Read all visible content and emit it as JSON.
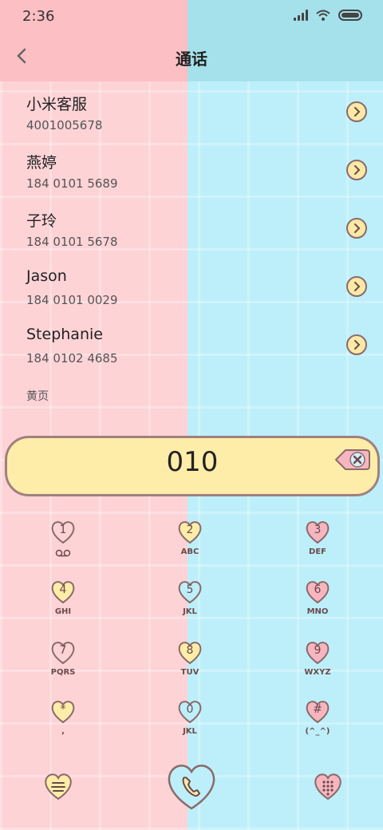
{
  "status": {
    "time": "2:36"
  },
  "header": {
    "title": "通话"
  },
  "contacts": [
    {
      "name": "小米客服",
      "phone": "4001005678"
    },
    {
      "name": "燕婷",
      "phone": "184 0101 5689"
    },
    {
      "name": "子玲",
      "phone": "184 0101 5678"
    },
    {
      "name": "Jason",
      "phone": "184 0101 0029"
    },
    {
      "name": "Stephanie",
      "phone": "184 0102 4685"
    }
  ],
  "section_label": "黄页",
  "dialer": {
    "number": "010"
  },
  "keypad": [
    {
      "digit": "1",
      "sub": ""
    },
    {
      "digit": "2",
      "sub": "ABC"
    },
    {
      "digit": "3",
      "sub": "DEF"
    },
    {
      "digit": "4",
      "sub": "GHI"
    },
    {
      "digit": "5",
      "sub": "JKL"
    },
    {
      "digit": "6",
      "sub": "MNO"
    },
    {
      "digit": "7",
      "sub": "PQRS"
    },
    {
      "digit": "8",
      "sub": "TUV"
    },
    {
      "digit": "9",
      "sub": "WXYZ"
    },
    {
      "digit": "*",
      "sub": ","
    },
    {
      "digit": "0",
      "sub": "JKL"
    },
    {
      "digit": "#",
      "sub": "(^_^)"
    }
  ],
  "colors": {
    "pink": "#fdd3d6",
    "cyan": "#bdeffa",
    "yellow": "#fdeda8",
    "heart_outline": "#8a6a6a"
  },
  "icons": {
    "voicemail": "voicemail-icon",
    "delete": "backspace-icon",
    "menu": "menu-icon",
    "call": "phone-icon",
    "keypad": "dialpad-icon"
  }
}
